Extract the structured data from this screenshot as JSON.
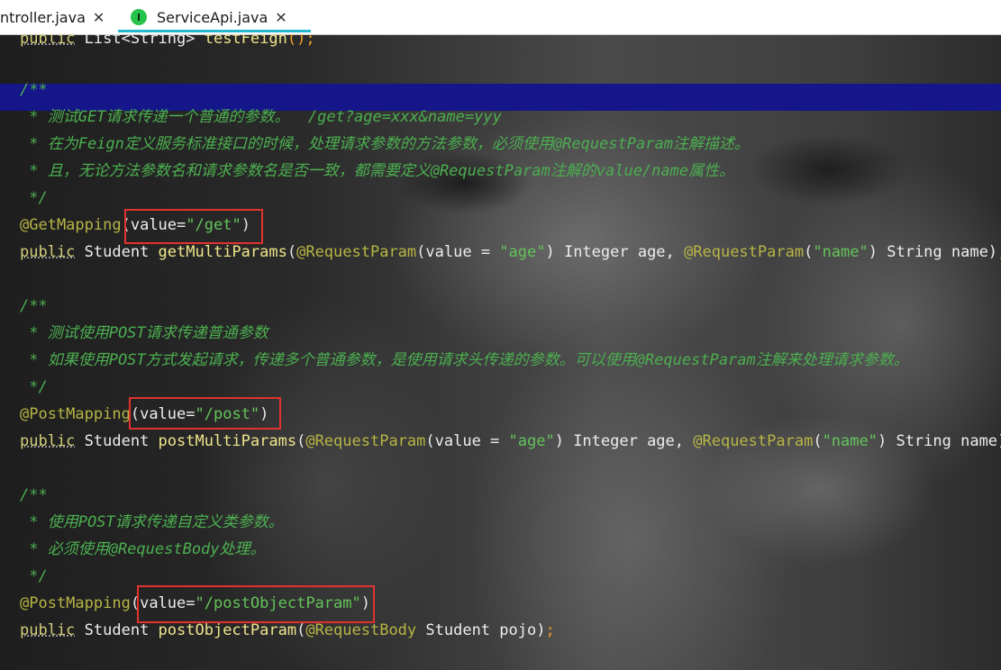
{
  "tabs": [
    {
      "label": "ntroller.java",
      "close": "✕"
    },
    {
      "label": "ServiceApi.java",
      "icon": "I",
      "close": "✕",
      "active": true
    }
  ],
  "code": {
    "l0": {
      "a": "public",
      "b": " List<String> ",
      "c": "testFeign",
      "d": "();"
    },
    "c1": {
      "open": "/**",
      "a": " * 测试GET请求传递一个普通的参数。  /get?age=xxx&name=yyy",
      "b": " * 在为Feign定义服务标准接口的时候，处理请求参数的方法参数，必须使用@RequestParam注解描述。",
      "c": " * 且，无论方法参数名和请求参数名是否一致，都需要定义@RequestParam注解的value/name属性。",
      "close": " */"
    },
    "get_ann": {
      "ann": "@GetMapping",
      "p1": "(",
      "id": "value=",
      "s": "\"/get\"",
      "p2": ")"
    },
    "get_sig": {
      "kw": "public",
      "t": " Student ",
      "fn": "getMultiParams",
      "p1": "(",
      "a1": "@RequestParam",
      "p2": "(",
      "v": "value = ",
      "s1": "\"age\"",
      "p3": ") Integer age, ",
      "a2": "@RequestParam",
      "p4": "(",
      "s2": "\"name\"",
      "p5": ") String name)",
      "semi": ";"
    },
    "c2": {
      "open": "/**",
      "a": " * 测试使用POST请求传递普通参数",
      "b": " * 如果使用POST方式发起请求，传递多个普通参数，是使用请求头传递的参数。可以使用@RequestParam注解来处理请求参数。",
      "close": " */"
    },
    "post_ann": {
      "ann": "@PostMapping",
      "p1": "(",
      "id": "value=",
      "s": "\"/post\"",
      "p2": ")"
    },
    "post_sig": {
      "kw": "public",
      "t": " Student ",
      "fn": "postMultiParams",
      "p1": "(",
      "a1": "@RequestParam",
      "p2": "(",
      "v": "value = ",
      "s1": "\"age\"",
      "p3": ") Integer age, ",
      "a2": "@RequestParam",
      "p4": "(",
      "s2": "\"name\"",
      "p5": ") String name)",
      "semi": ";"
    },
    "c3": {
      "open": "/**",
      "a": " * 使用POST请求传递自定义类参数。",
      "b": " * 必须使用@RequestBody处理。",
      "close": " */"
    },
    "obj_ann": {
      "ann": "@PostMapping",
      "p1": "(",
      "id": "value=",
      "s": "\"/postObjectParam\"",
      "p2": ")"
    },
    "obj_sig": {
      "kw": "public",
      "t": " Student ",
      "fn": "postObjectParam",
      "p1": "(",
      "a1": "@RequestBody",
      "p3": " Student pojo)",
      "semi": ";"
    }
  },
  "colors": {
    "comment": "#4caf50",
    "annotation": "#b7b545",
    "string": "#64c35a",
    "highlight": "#14168a",
    "redbox": "#e0322f",
    "tab_accent": "#24b8cf",
    "interface_icon": "#27c24c"
  }
}
